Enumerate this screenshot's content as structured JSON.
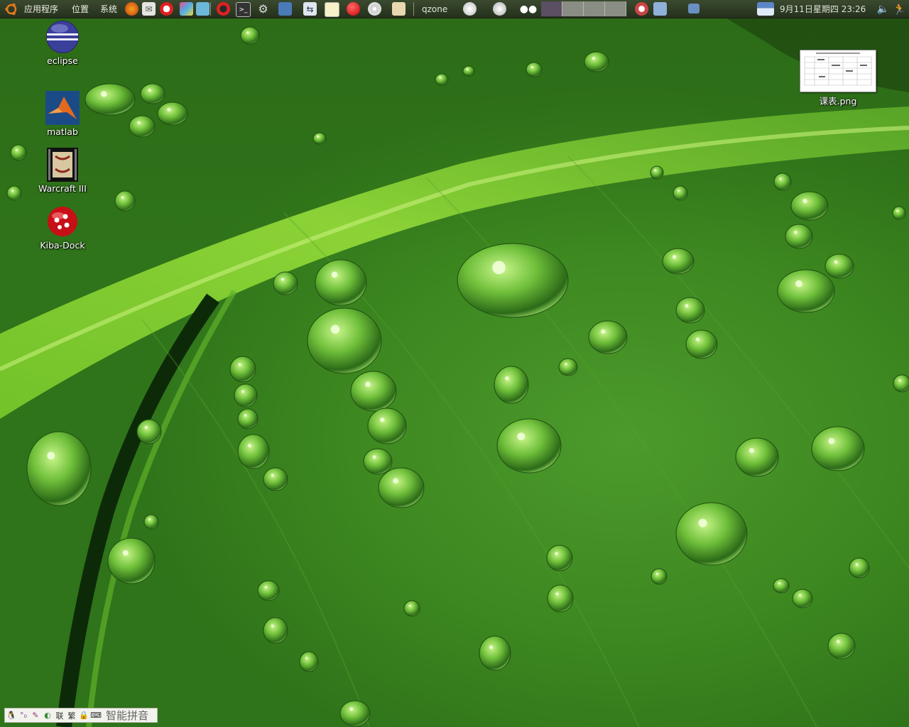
{
  "top_panel": {
    "menus": [
      "应用程序",
      "位置",
      "系统"
    ],
    "launcher_icons": [
      "firefox-icon",
      "mail-icon",
      "help-icon",
      "paint-icon",
      "opera-icon",
      "terminal-icon",
      "settings-icon",
      "network-icon",
      "remote-desktop-icon",
      "screenshot-icon",
      "kiba-dock-icon",
      "cd-icon",
      "gimp-icon"
    ],
    "task_label": "qzone",
    "clock": "9月11日星期四 23:26"
  },
  "desktop_icons": [
    {
      "label": "eclipse",
      "icon": "eclipse-icon"
    },
    {
      "label": "matlab",
      "icon": "matlab-icon"
    },
    {
      "label": "Warcraft III",
      "icon": "warcraft-icon"
    },
    {
      "label": "Kiba-Dock",
      "icon": "kiba-dock-icon"
    },
    {
      "label": "课表.png",
      "icon": "image-file-icon"
    }
  ],
  "ime_bar": {
    "icons": [
      "tux-icon",
      "punctuation-icon",
      "brush-icon",
      "fullwidth-icon",
      "simplified-icon",
      "traditional-icon",
      "lock-icon",
      "keyboard-icon"
    ],
    "mode_text": [
      "联",
      "繁"
    ],
    "label": "智能拼音"
  },
  "colors": {
    "panel": "#2c3a24",
    "wallpaper": "#3d8820",
    "accent_red": "#d8121a"
  }
}
